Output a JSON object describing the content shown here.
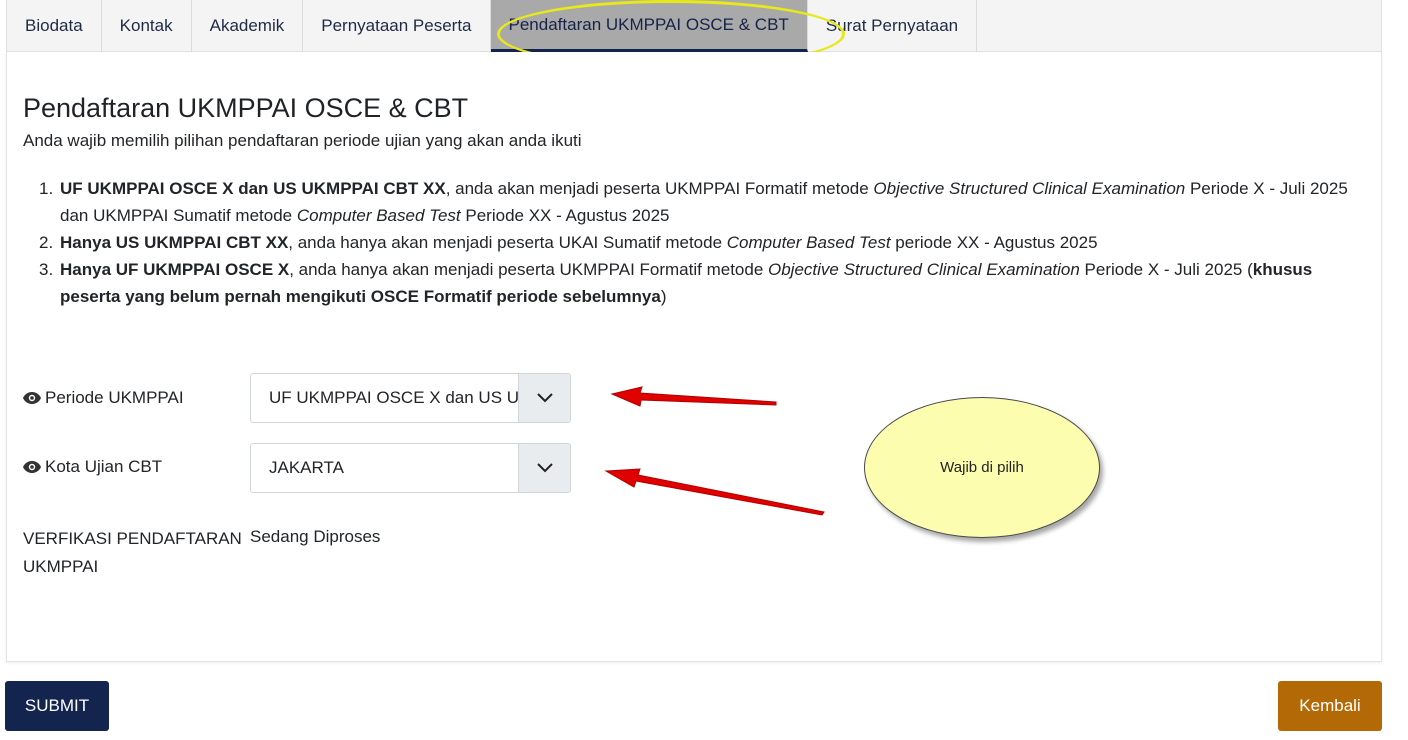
{
  "tabs": [
    "Biodata",
    "Kontak",
    "Akademik",
    "Pernyataan Peserta",
    "Pendaftaran UKMPPAI OSCE & CBT",
    "Surat Pernyataan"
  ],
  "active_tab": "Pendaftaran UKMPPAI OSCE & CBT",
  "page": {
    "title": "Pendaftaran UKMPPAI OSCE & CBT",
    "subtitle": "Anda wajib memilih pilihan pendaftaran periode ujian yang akan anda ikuti"
  },
  "options": [
    {
      "num": "1.",
      "bold": "UF UKMPPAI OSCE X dan US UKMPPAI CBT XX",
      "t1": ", anda akan menjadi peserta UKMPPAI Formatif metode ",
      "i1": "Objective Structured Clinical Examination",
      "t2": " Periode X - Juli 2025 dan UKMPPAI Sumatif metode ",
      "i2": "Computer Based Test",
      "t3": " Periode XX - Agustus 2025"
    },
    {
      "num": "2.",
      "bold": "Hanya US UKMPPAI CBT XX",
      "t1": ", anda hanya akan menjadi peserta UKAI Sumatif metode ",
      "i1": "Computer Based Test",
      "t2": " periode XX - Agustus 2025"
    },
    {
      "num": "3.",
      "bold": "Hanya UF UKMPPAI OSCE X",
      "t1": ", anda hanya akan menjadi peserta UKMPPAI Formatif metode ",
      "i1": "Objective Structured Clinical Examination",
      "t2": " Periode X - Juli 2025 (",
      "bold2": "khusus peserta yang belum pernah mengikuti OSCE Formatif periode sebelumnya",
      "t3": ")"
    }
  ],
  "form": {
    "periode_label": "Periode UKMPPAI",
    "periode_value": "UF UKMPPAI OSCE X dan US UKMPPAI CBT XX",
    "kota_label": "Kota Ujian CBT",
    "kota_value": "JAKARTA",
    "verif_label": "VERFIKASI PENDAFTARAN UKMPPAI",
    "verif_value": "Sedang Diproses"
  },
  "buttons": {
    "submit": "SUBMIT",
    "back": "Kembali"
  },
  "annotation": {
    "callout_text": "Wajib di pilih"
  },
  "colors": {
    "primary": "#13254f",
    "back": "#b36a06",
    "highlight": "#e8e81a",
    "arrow": "#e00000",
    "callout": "#fdfdb0"
  },
  "icons": {
    "field_icon": "eye-icon",
    "select_icon": "chevron-down-icon"
  }
}
